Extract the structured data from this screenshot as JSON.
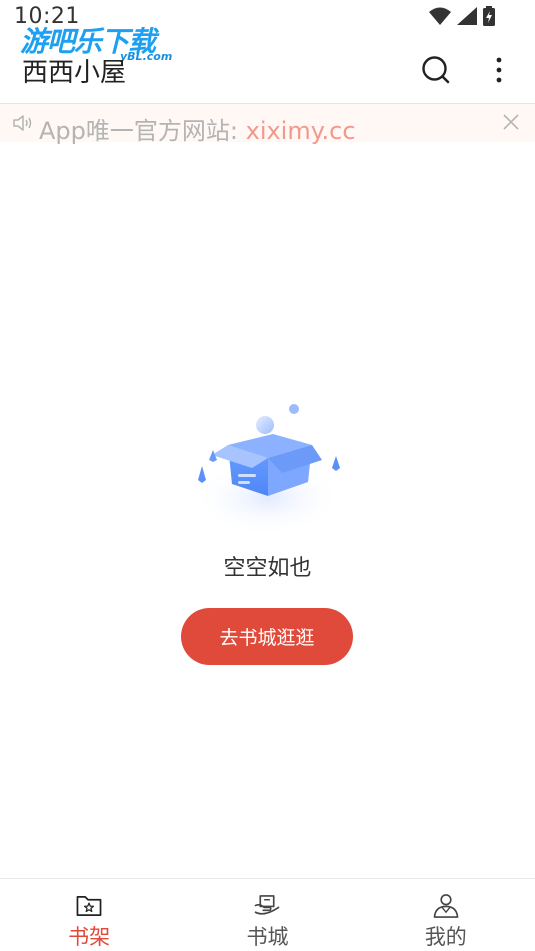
{
  "status_bar": {
    "time": "10:21"
  },
  "watermark": {
    "text": "游吧乐下载",
    "sub": "yBL.com"
  },
  "header": {
    "title": "西西小屋",
    "search_icon": "search-icon",
    "more_icon": "more-vertical-icon"
  },
  "notice": {
    "prefix": "App唯一官方网站: ",
    "link": "xiximy.cc",
    "icon": "speaker-icon",
    "close_icon": "close-icon"
  },
  "empty_state": {
    "illustration": "empty-box-icon",
    "text": "空空如也",
    "button_label": "去书城逛逛"
  },
  "bottom_nav": {
    "items": [
      {
        "label": "书架",
        "icon": "bookshelf-icon",
        "active": true
      },
      {
        "label": "书城",
        "icon": "bookstore-icon",
        "active": false
      },
      {
        "label": "我的",
        "icon": "profile-icon",
        "active": false
      }
    ]
  },
  "colors": {
    "accent": "#e04a3a",
    "notice_bg": "#fff8f5",
    "notice_link": "#f2998c",
    "illustration_blue": "#5b8ff9"
  }
}
